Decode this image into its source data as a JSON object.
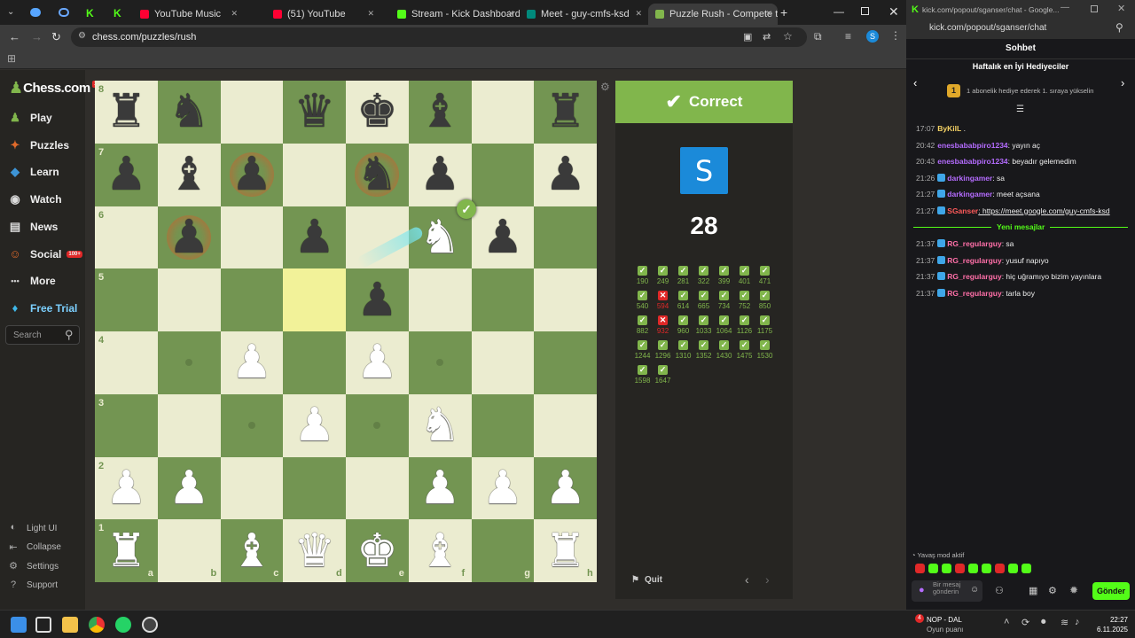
{
  "browser": {
    "tabs": [
      {
        "label": "YouTube Music",
        "color": "#ff0033"
      },
      {
        "label": "(51) YouTube",
        "color": "#ff0033"
      },
      {
        "label": "Stream - Kick Dashboard",
        "color": "#53fc18"
      },
      {
        "label": "Meet - guy-cmfs-ksd",
        "color": "#00897b"
      },
      {
        "label": "Puzzle Rush - Compete to S",
        "color": "#81b64c"
      }
    ],
    "url": "chess.com/puzzles/rush"
  },
  "sidebar": {
    "logo": "Chess.com",
    "logo_badge": "11",
    "items": [
      {
        "label": "Play",
        "icon": "pawn-icon"
      },
      {
        "label": "Puzzles",
        "icon": "puzzle-icon"
      },
      {
        "label": "Learn",
        "icon": "learn-icon"
      },
      {
        "label": "Watch",
        "icon": "watch-icon"
      },
      {
        "label": "News",
        "icon": "news-icon"
      },
      {
        "label": "Social",
        "icon": "social-icon",
        "badge": "100+"
      },
      {
        "label": "More",
        "icon": "more-icon"
      },
      {
        "label": "Free Trial",
        "icon": "diamond-icon"
      }
    ],
    "search_placeholder": "Search",
    "bottom": [
      {
        "label": "Light UI"
      },
      {
        "label": "Collapse"
      },
      {
        "label": "Settings"
      },
      {
        "label": "Support"
      }
    ]
  },
  "board": {
    "ranks": [
      "8",
      "7",
      "6",
      "5",
      "4",
      "3",
      "2",
      "1"
    ],
    "files": [
      "a",
      "b",
      "c",
      "d",
      "e",
      "f",
      "g",
      "h"
    ],
    "pieces": [
      {
        "sq": "a8",
        "p": "♜",
        "c": "b"
      },
      {
        "sq": "b8",
        "p": "♞",
        "c": "b"
      },
      {
        "sq": "d8",
        "p": "♛",
        "c": "b"
      },
      {
        "sq": "e8",
        "p": "♚",
        "c": "b"
      },
      {
        "sq": "f8",
        "p": "♝",
        "c": "b"
      },
      {
        "sq": "h8",
        "p": "♜",
        "c": "b"
      },
      {
        "sq": "a7",
        "p": "♟",
        "c": "b"
      },
      {
        "sq": "b7",
        "p": "♝",
        "c": "b"
      },
      {
        "sq": "c7",
        "p": "♟",
        "c": "b"
      },
      {
        "sq": "e7",
        "p": "♞",
        "c": "b"
      },
      {
        "sq": "f7",
        "p": "♟",
        "c": "b"
      },
      {
        "sq": "h7",
        "p": "♟",
        "c": "b"
      },
      {
        "sq": "b6",
        "p": "♟",
        "c": "b"
      },
      {
        "sq": "d6",
        "p": "♟",
        "c": "b"
      },
      {
        "sq": "g6",
        "p": "♟",
        "c": "b"
      },
      {
        "sq": "e5",
        "p": "♟",
        "c": "b"
      },
      {
        "sq": "f6",
        "p": "♞",
        "c": "w"
      },
      {
        "sq": "c4",
        "p": "♟",
        "c": "w"
      },
      {
        "sq": "e4",
        "p": "♟",
        "c": "w"
      },
      {
        "sq": "d3",
        "p": "♟",
        "c": "w"
      },
      {
        "sq": "f3",
        "p": "♞",
        "c": "w"
      },
      {
        "sq": "a2",
        "p": "♟",
        "c": "w"
      },
      {
        "sq": "b2",
        "p": "♟",
        "c": "w"
      },
      {
        "sq": "f2",
        "p": "♟",
        "c": "w"
      },
      {
        "sq": "g2",
        "p": "♟",
        "c": "w"
      },
      {
        "sq": "h2",
        "p": "♟",
        "c": "w"
      },
      {
        "sq": "a1",
        "p": "♜",
        "c": "w"
      },
      {
        "sq": "c1",
        "p": "♝",
        "c": "w"
      },
      {
        "sq": "d1",
        "p": "♛",
        "c": "w"
      },
      {
        "sq": "e1",
        "p": "♚",
        "c": "w"
      },
      {
        "sq": "f1",
        "p": "♝",
        "c": "w"
      },
      {
        "sq": "h1",
        "p": "♜",
        "c": "w"
      }
    ],
    "dots": [
      "b4",
      "f4",
      "c3",
      "e3"
    ],
    "highlight": [
      "d5"
    ],
    "rings": [
      "c7",
      "e7",
      "b6"
    ]
  },
  "puzzle": {
    "status": "Correct",
    "avatar_letter": "S",
    "score": "28",
    "results": [
      {
        "v": "190",
        "ok": true
      },
      {
        "v": "249",
        "ok": true
      },
      {
        "v": "281",
        "ok": true
      },
      {
        "v": "322",
        "ok": true
      },
      {
        "v": "399",
        "ok": true
      },
      {
        "v": "401",
        "ok": true
      },
      {
        "v": "471",
        "ok": true
      },
      {
        "v": "540",
        "ok": true
      },
      {
        "v": "594",
        "ok": false
      },
      {
        "v": "614",
        "ok": true
      },
      {
        "v": "665",
        "ok": true
      },
      {
        "v": "734",
        "ok": true
      },
      {
        "v": "752",
        "ok": true
      },
      {
        "v": "850",
        "ok": true
      },
      {
        "v": "882",
        "ok": true
      },
      {
        "v": "932",
        "ok": false
      },
      {
        "v": "960",
        "ok": true
      },
      {
        "v": "1033",
        "ok": true
      },
      {
        "v": "1064",
        "ok": true
      },
      {
        "v": "1126",
        "ok": true
      },
      {
        "v": "1175",
        "ok": true
      },
      {
        "v": "1244",
        "ok": true
      },
      {
        "v": "1296",
        "ok": true
      },
      {
        "v": "1310",
        "ok": true
      },
      {
        "v": "1352",
        "ok": true
      },
      {
        "v": "1430",
        "ok": true
      },
      {
        "v": "1475",
        "ok": true
      },
      {
        "v": "1530",
        "ok": true
      },
      {
        "v": "1598",
        "ok": true
      },
      {
        "v": "1647",
        "ok": true
      }
    ],
    "quit_label": "Quit"
  },
  "chat": {
    "window_title": "kick.com/popout/sganser/chat - Google...",
    "url": "kick.com/popout/sganser/chat",
    "header": "Sohbet",
    "gifters_title": "Haftalık en İyi Hediyeciler",
    "gifter_rank": "1",
    "gifter_text": "1 abonelik hediye ederek 1. sıraya yükselin",
    "messages": [
      {
        "t": "17:07",
        "u": "ByKilL",
        "m": " .",
        "color": "#f6d365",
        "badge": false
      },
      {
        "t": "20:42",
        "u": "enesbababpiro1234",
        "m": ": yayın aç",
        "color": "#b56cff",
        "badge": false
      },
      {
        "t": "20:43",
        "u": "enesbababpiro1234",
        "m": ": beyadır gelemedim",
        "color": "#b56cff",
        "badge": false
      },
      {
        "t": "21:26",
        "u": "darkingamer",
        "m": ": sa",
        "color": "#b56cff",
        "badge": true
      },
      {
        "t": "21:27",
        "u": "darkingamer",
        "m": ": meet açsana",
        "color": "#b56cff",
        "badge": true
      },
      {
        "t": "21:27",
        "u": "SGanser",
        "m": ": https://meet.google.com/guy-cmfs-ksd",
        "color": "#ff5a5a",
        "badge": true
      }
    ],
    "new_messages": "Yeni mesajlar",
    "messages2": [
      {
        "t": "21:37",
        "u": "RG_regularguy",
        "m": ": sa",
        "color": "#ff6fa8",
        "badge": true
      },
      {
        "t": "21:37",
        "u": "RG_regularguy",
        "m": ": yusuf napıyo",
        "color": "#ff6fa8",
        "badge": true
      },
      {
        "t": "21:37",
        "u": "RG_regularguy",
        "m": ": hiç uğramıyo bizim yayınlara",
        "color": "#ff6fa8",
        "badge": true
      },
      {
        "t": "21:37",
        "u": "RG_regularguy",
        "m": ": tarla boy",
        "color": "#ff6fa8",
        "badge": true
      }
    ],
    "slow_mode": "Yavaş mod aktif",
    "input_placeholder": "Bir mesaj gönderin",
    "send_label": "Gönder"
  },
  "taskbar": {
    "game_title": "NOP - DAL",
    "game_sub": "Oyun puanı",
    "badge": "4",
    "time": "22:27",
    "date": "6.11.2025"
  }
}
